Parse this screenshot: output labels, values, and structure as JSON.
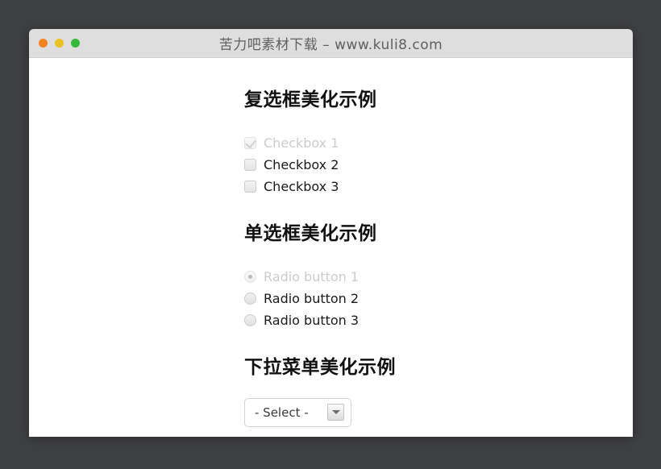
{
  "window": {
    "title": "苦力吧素材下载 – www.kuli8.com",
    "traffic_lights": [
      {
        "name": "close",
        "color": "#f58220"
      },
      {
        "name": "minimize",
        "color": "#ebc223"
      },
      {
        "name": "zoom",
        "color": "#36b83b"
      }
    ]
  },
  "sections": [
    {
      "heading": "复选框美化示例",
      "type": "checkbox",
      "options": [
        {
          "label": "Checkbox 1",
          "checked": true,
          "disabled": true
        },
        {
          "label": "Checkbox 2",
          "checked": false,
          "disabled": false
        },
        {
          "label": "Checkbox 3",
          "checked": false,
          "disabled": false
        }
      ]
    },
    {
      "heading": "单选框美化示例",
      "type": "radio",
      "options": [
        {
          "label": "Radio button 1",
          "checked": true,
          "disabled": true
        },
        {
          "label": "Radio button 2",
          "checked": false,
          "disabled": false
        },
        {
          "label": "Radio button 3",
          "checked": false,
          "disabled": false
        }
      ]
    },
    {
      "heading": "下拉菜单美化示例",
      "type": "select",
      "select": {
        "value": "- Select -",
        "options": [
          "- Select -"
        ]
      }
    }
  ],
  "colors": {
    "desktop_background": "#3f4042",
    "titlebar": "#dedede",
    "page_background": "#ffffff",
    "heading_text": "#111111",
    "label_text": "#1a1a1a",
    "disabled_text": "#cccccc"
  }
}
